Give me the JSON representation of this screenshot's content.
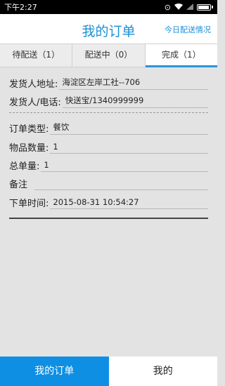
{
  "status_bar": {
    "time": "下午2:27"
  },
  "header": {
    "title": "我的订单",
    "link": "今日配送情况"
  },
  "tabs": [
    {
      "label": "待配送（1）",
      "active": false
    },
    {
      "label": "配送中（0）",
      "active": false
    },
    {
      "label": "完成（1）",
      "active": true
    }
  ],
  "order": {
    "sender_address_label": "发货人地址:",
    "sender_address": "海淀区左岸工社--706",
    "sender_contact_label": "发货人/电话:",
    "sender_contact": "快送宝/1340999999",
    "order_type_label": "订单类型:",
    "order_type": "餐饮",
    "item_count_label": "物品数量:",
    "item_count": "1",
    "total_label": "总单量:",
    "total": "1",
    "remark_label": "备注",
    "remark": "",
    "order_time_label": "下单时间:",
    "order_time": "2015-08-31 10:54:27"
  },
  "bottom_nav": [
    {
      "label": "我的订单",
      "active": true
    },
    {
      "label": "我的",
      "active": false
    }
  ],
  "colors": {
    "accent": "#1a8fd6",
    "nav_active": "#0f8fe3"
  }
}
